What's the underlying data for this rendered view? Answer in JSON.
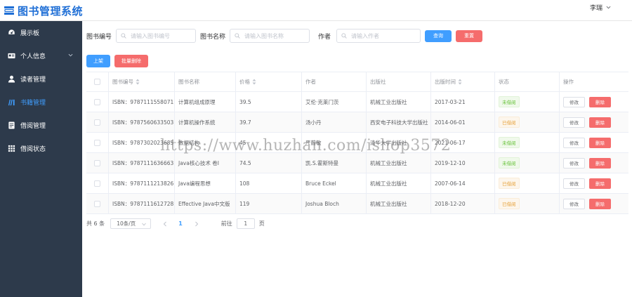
{
  "app": {
    "title": "图书管理系统"
  },
  "user": {
    "name": "李瑞"
  },
  "sidebar": {
    "items": [
      {
        "label": "展示板",
        "icon": "dashboard-icon"
      },
      {
        "label": "个人信息",
        "icon": "id-card-icon"
      },
      {
        "label": "读者管理",
        "icon": "user-icon"
      },
      {
        "label": "书籍管理",
        "icon": "books-icon",
        "active": true
      },
      {
        "label": "借阅管理",
        "icon": "form-icon"
      },
      {
        "label": "借阅状态",
        "icon": "grid-icon"
      }
    ]
  },
  "search": {
    "isbn_label": "图书编号",
    "isbn_placeholder": "请输入图书编号",
    "name_label": "图书名称",
    "name_placeholder": "请输入图书名称",
    "author_label": "作者",
    "author_placeholder": "请输入作者",
    "search_btn": "查询",
    "reset_btn": "重置"
  },
  "actions": {
    "add_btn": "上架",
    "batch_delete_btn": "批量删除"
  },
  "table": {
    "headers": [
      "图书编号",
      "图书名称",
      "价格",
      "作者",
      "出版社",
      "出版时间",
      "状态",
      "操作"
    ],
    "rows": [
      {
        "isbn": "ISBN：9787111558071",
        "name": "计算机组成原理",
        "price": "39.5",
        "author": "艾伦·克莱门茨",
        "publisher": "机械工业出版社",
        "date": "2017-03-21",
        "status": "未借阅"
      },
      {
        "isbn": "ISBN：9787560633503",
        "name": "计算机操作系统",
        "price": "39.7",
        "author": "汤小丹",
        "publisher": "西安电子科技大学出版社",
        "date": "2014-06-01",
        "status": "已借阅"
      },
      {
        "isbn": "ISBN：9787302023685",
        "name": "数据结构",
        "price": "45",
        "author": "严蔚敏",
        "publisher": "清华大学出版社",
        "date": "2021-06-17",
        "status": "未借阅"
      },
      {
        "isbn": "ISBN：9787111636663",
        "name": "Java核心技术 卷I",
        "price": "74.5",
        "author": "凯.S.霍斯特曼",
        "publisher": "机械工业出版社",
        "date": "2019-12-10",
        "status": "未借阅"
      },
      {
        "isbn": "ISBN：9787111213826",
        "name": "Java编程思想",
        "price": "108",
        "author": "Bruce Eckel",
        "publisher": "机械工业出版社",
        "date": "2007-06-14",
        "status": "已借阅"
      },
      {
        "isbn": "ISBN：9787111612728",
        "name": "Effective Java中文版",
        "price": "119",
        "author": "Joshua Bloch",
        "publisher": "机械工业出版社",
        "date": "2018-12-20",
        "status": "已借阅"
      }
    ],
    "edit_btn": "修改",
    "delete_btn": "删除"
  },
  "pagination": {
    "total": "共 6 条",
    "page_size": "10条/页",
    "current": "1",
    "goto_prefix": "前往",
    "goto_value": "1",
    "goto_suffix": "页"
  },
  "watermark": "https://www.huzhan.com/ishop3572",
  "colors": {
    "primary": "#409eff",
    "danger": "#f56c6c",
    "sidebar_bg": "#2d3a4b",
    "success": "#67c23a",
    "warning": "#e6a23c"
  }
}
